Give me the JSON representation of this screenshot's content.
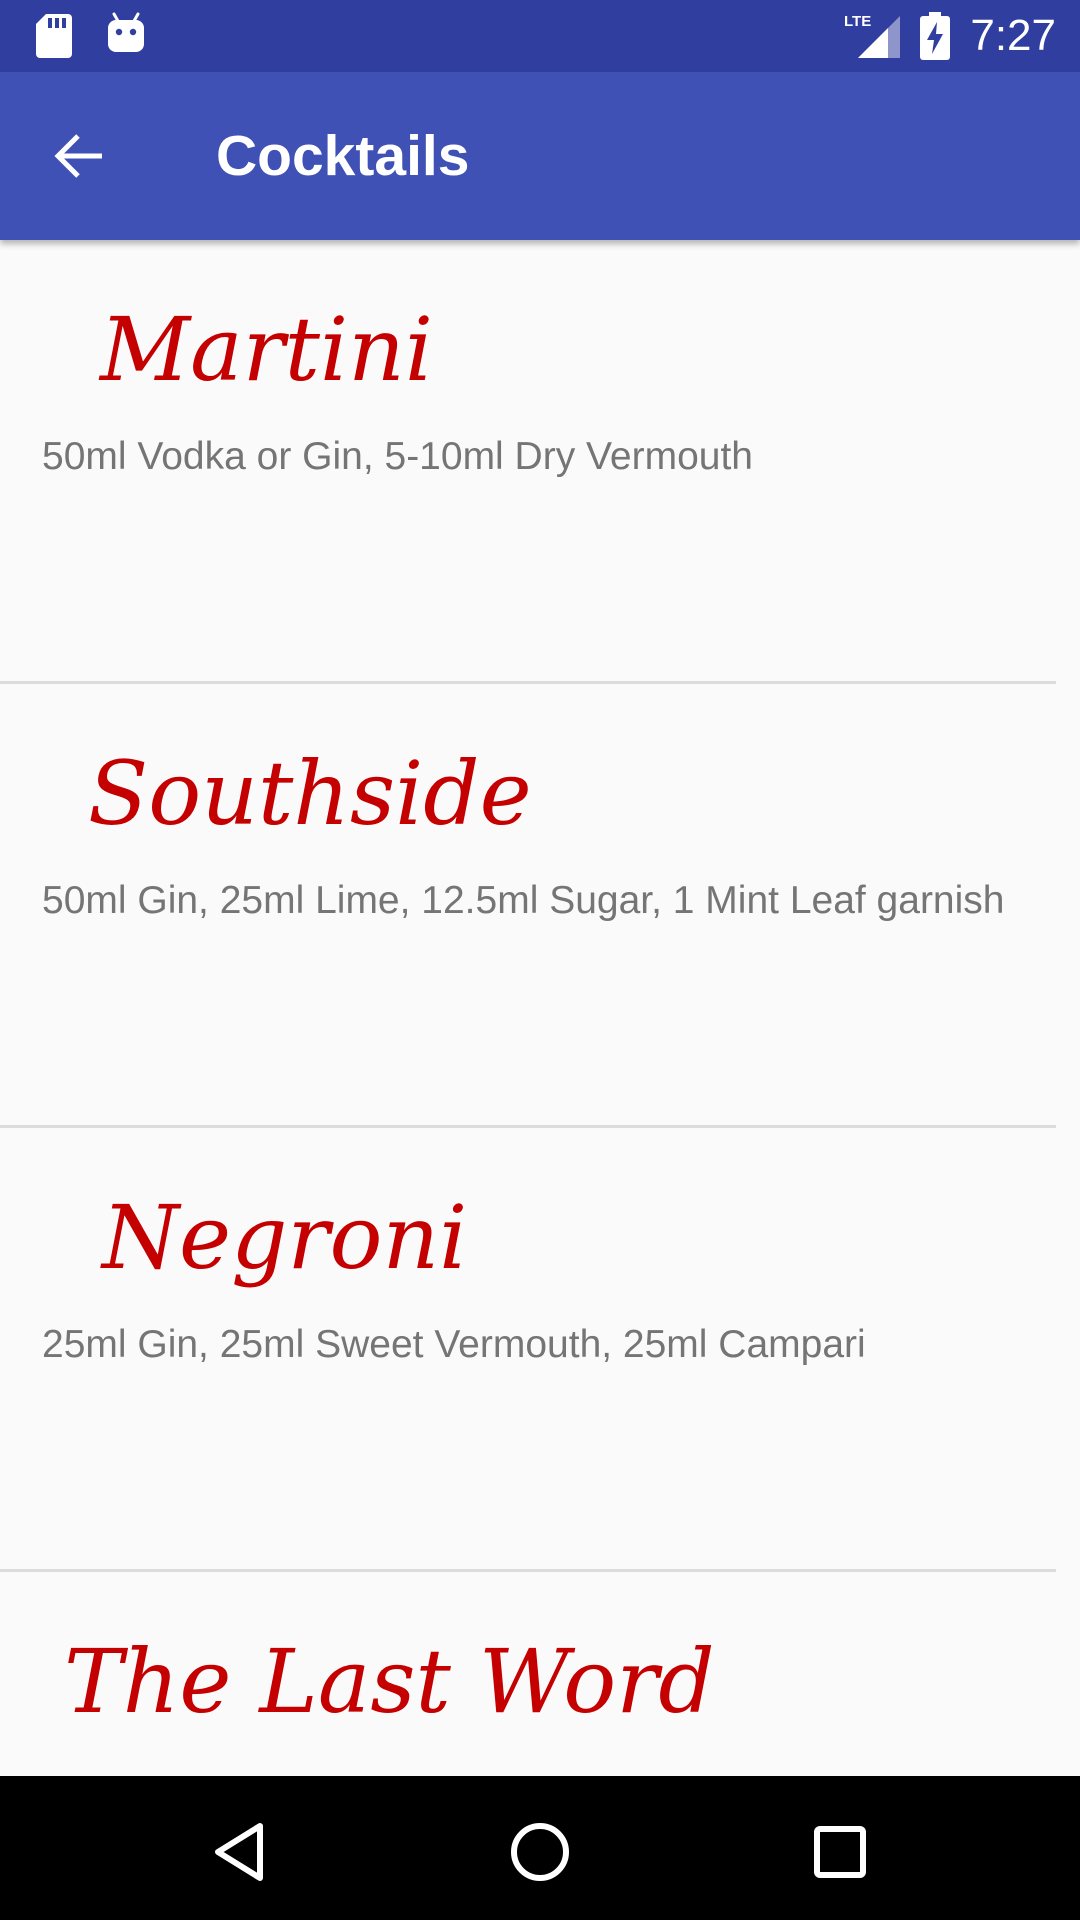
{
  "status_bar": {
    "time": "7:27",
    "icons": [
      "sd-card-icon",
      "android-debug-icon",
      "lte-signal-icon",
      "battery-charging-icon"
    ],
    "network_label": "LTE"
  },
  "app_bar": {
    "title": "Cocktails",
    "back_icon": "arrow-back-icon"
  },
  "cocktails": [
    {
      "name": "Martini",
      "ingredients": "50ml Vodka or Gin, 5-10ml Dry Vermouth"
    },
    {
      "name": "Southside",
      "ingredients": "50ml Gin, 25ml Lime, 12.5ml Sugar, 1 Mint Leaf garnish"
    },
    {
      "name": "Negroni",
      "ingredients": "25ml Gin, 25ml Sweet Vermouth, 25ml Campari"
    },
    {
      "name": "The Last Word",
      "ingredients": ""
    }
  ],
  "nav_bar": {
    "buttons": [
      "nav-back-icon",
      "nav-home-icon",
      "nav-recents-icon"
    ]
  },
  "colors": {
    "status_bar": "#303f9f",
    "app_bar": "#3f51b5",
    "cocktail_name": "#c40000",
    "ingredients_text": "#757575",
    "background": "#fafafa"
  }
}
